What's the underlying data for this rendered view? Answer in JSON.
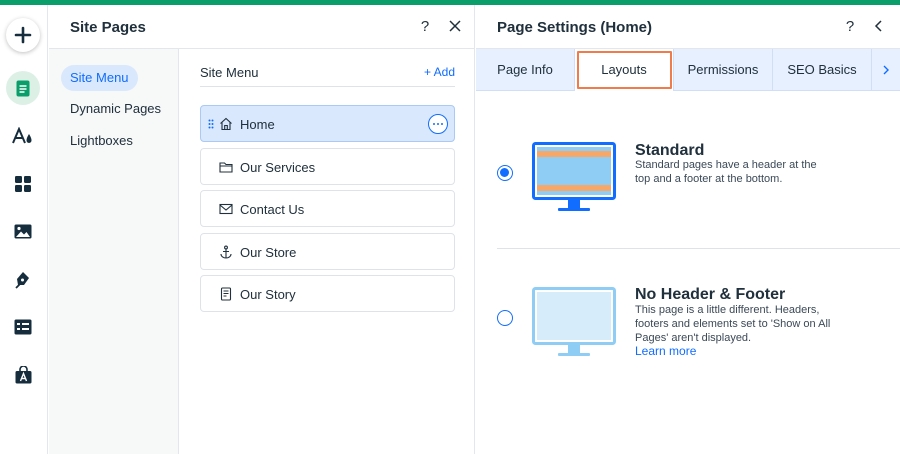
{
  "colors": {
    "accent_green": "#0a9e6b",
    "accent_blue": "#116dff",
    "highlight_orange": "#f07c4c"
  },
  "rail": {
    "items": [
      {
        "icon": "plus-icon"
      },
      {
        "icon": "pages-icon"
      },
      {
        "icon": "design-icon"
      },
      {
        "icon": "apps-grid-icon"
      },
      {
        "icon": "media-icon"
      },
      {
        "icon": "pen-icon"
      },
      {
        "icon": "table-icon"
      },
      {
        "icon": "app-market-icon"
      }
    ]
  },
  "site_pages": {
    "title": "Site Pages",
    "help_label": "?",
    "close_label": "✕",
    "nav": [
      {
        "label": "Site Menu"
      },
      {
        "label": "Dynamic Pages"
      },
      {
        "label": "Lightboxes"
      }
    ],
    "menu": {
      "title": "Site Menu",
      "add_label": "+ Add",
      "pages": [
        {
          "label": "Home",
          "icon": "home-icon"
        },
        {
          "label": "Our Services",
          "icon": "folder-icon"
        },
        {
          "label": "Contact Us",
          "icon": "mail-icon"
        },
        {
          "label": "Our Store",
          "icon": "anchor-icon"
        },
        {
          "label": "Our Story",
          "icon": "document-icon"
        }
      ]
    }
  },
  "page_settings": {
    "title": "Page Settings (Home)",
    "help_label": "?",
    "tabs": [
      {
        "label": "Page Info"
      },
      {
        "label": "Layouts"
      },
      {
        "label": "Permissions"
      },
      {
        "label": "SEO Basics"
      }
    ],
    "layouts": [
      {
        "name": "Standard",
        "description": "Standard pages have a header at the top and a footer at the bottom.",
        "selected": true
      },
      {
        "name": "No Header & Footer",
        "description": "This page is a little different. Headers, footers and elements set to 'Show on All Pages' aren't displayed.",
        "link": "Learn more",
        "selected": false
      }
    ]
  }
}
